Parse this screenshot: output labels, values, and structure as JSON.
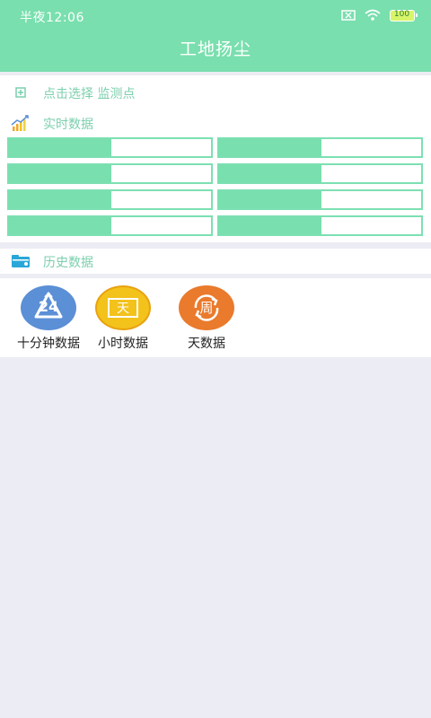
{
  "status": {
    "time": "半夜12:06",
    "battery": "100"
  },
  "header": {
    "title": "工地扬尘"
  },
  "monitor": {
    "select_label": "点击选择 监测点"
  },
  "realtime": {
    "label": "实时数据"
  },
  "history": {
    "label": "历史数据"
  },
  "apps": [
    {
      "label": "十分钟数据",
      "glyph": "24",
      "color": "#5b8fd6",
      "icon": "recycle-24-icon"
    },
    {
      "label": "小时数据",
      "glyph": "天",
      "color": "#f3c21b",
      "icon": "day-screen-icon"
    },
    {
      "label": "天数据",
      "glyph": "周",
      "color": "#ea7a2c",
      "icon": "week-cycle-icon"
    }
  ],
  "colors": {
    "accent": "#79dfae",
    "background": "#ececf4"
  }
}
